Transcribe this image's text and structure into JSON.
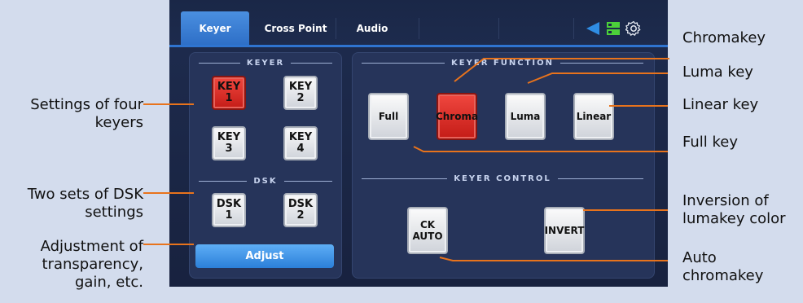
{
  "tabs": [
    {
      "label": "Keyer",
      "active": true
    },
    {
      "label": "Cross Point",
      "active": false
    },
    {
      "label": "Audio",
      "active": false
    }
  ],
  "toolbar_icons": [
    "back-arrow-icon",
    "layout-icon",
    "gear-icon"
  ],
  "keyer_section": {
    "title": "KEYER",
    "buttons": [
      {
        "top": "KEY",
        "bottom": "1",
        "active": true
      },
      {
        "top": "KEY",
        "bottom": "2",
        "active": false
      },
      {
        "top": "KEY",
        "bottom": "3",
        "active": false
      },
      {
        "top": "KEY",
        "bottom": "4",
        "active": false
      }
    ]
  },
  "dsk_section": {
    "title": "DSK",
    "buttons": [
      {
        "top": "DSK",
        "bottom": "1"
      },
      {
        "top": "DSK",
        "bottom": "2"
      }
    ]
  },
  "adjust_label": "Adjust",
  "keyer_function": {
    "title": "KEYER FUNCTION",
    "buttons": [
      {
        "label": "Full",
        "active": false
      },
      {
        "label": "Chroma",
        "active": true
      },
      {
        "label": "Luma",
        "active": false
      },
      {
        "label": "Linear",
        "active": false
      }
    ]
  },
  "keyer_control": {
    "title": "KEYER CONTROL",
    "buttons": [
      {
        "top": "CK",
        "bottom": "AUTO"
      },
      {
        "top": "INVERT",
        "bottom": ""
      }
    ]
  },
  "callouts": {
    "left": [
      "Settings of four keyers",
      "Two sets of DSK settings",
      "Adjustment of transparency, gain, etc."
    ],
    "right": [
      "Chromakey",
      "Luma key",
      "Linear key",
      "Full key",
      "Inversion of lumakey color",
      "Auto chromakey"
    ]
  },
  "colors": {
    "leader": "#e8731c",
    "panel": "#1e2c4f",
    "active_tab": "#3a80d8",
    "red_button": "#d92a24"
  }
}
